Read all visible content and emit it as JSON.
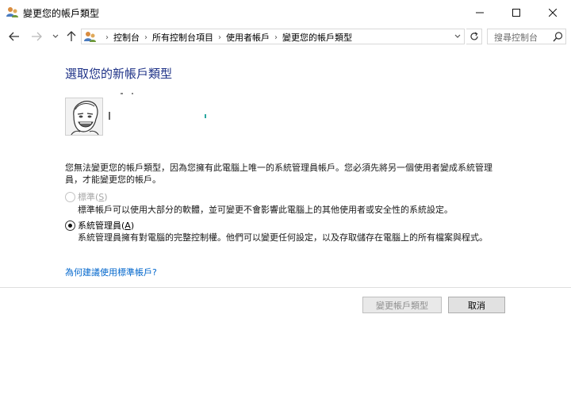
{
  "window": {
    "title": "變更您的帳戶類型",
    "minimize_glyph": "—",
    "close_glyph": "✕"
  },
  "address_bar": {
    "crumbs": [
      "控制台",
      "所有控制台項目",
      "使用者帳戶",
      "變更您的帳戶類型"
    ],
    "search_placeholder": "搜尋控制台"
  },
  "main": {
    "heading": "選取您的新帳戶類型",
    "warning": "您無法變更您的帳戶類型，因為您擁有此電腦上唯一的系統管理員帳戶。您必須先將另一個使用者變成系統管理員，才能變更您的帳戶。",
    "options": {
      "standard": {
        "label": "標準",
        "accel": "S",
        "description": "標準帳戶可以使用大部分的軟體，並可變更不會影響此電腦上的其他使用者或安全性的系統設定。",
        "enabled": false,
        "selected": false
      },
      "admin": {
        "label": "系統管理員",
        "accel": "A",
        "description": "系統管理員擁有對電腦的完整控制權。他們可以變更任何設定，以及存取儲存在電腦上的所有檔案與程式。",
        "enabled": true,
        "selected": true
      }
    },
    "help_link": "為何建議使用標準帳戶?"
  },
  "buttons": {
    "change": "變更帳戶類型",
    "cancel": "取消"
  },
  "colors": {
    "heading": "#1e3287",
    "link": "#0066cc",
    "disabled_text": "#a6a6a6"
  }
}
